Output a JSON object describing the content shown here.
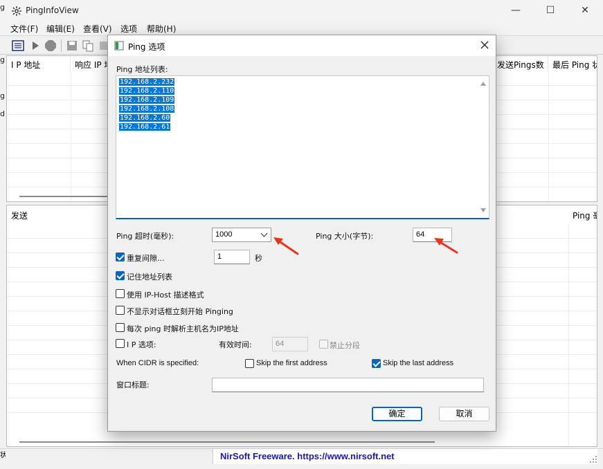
{
  "app": {
    "title": "PingInfoView",
    "window_controls": {
      "minimize": "—",
      "maximize": "☐",
      "close": "✕"
    }
  },
  "menu": [
    "文件(F)",
    "编辑(E)",
    "查看(V)",
    "选项",
    "帮助(H)"
  ],
  "top_table": {
    "columns": [
      "I P 地址",
      "响应 IP 地",
      "发送Pings数",
      "最后 Ping 状"
    ],
    "left_clipped_chars": [
      "g",
      "g",
      "g",
      "d"
    ]
  },
  "bottom_table": {
    "columns": [
      "发送",
      "Ping 毫。"
    ]
  },
  "status": {
    "left_text": "状",
    "link_text": "NirSoft Freeware. https://www.nirsoft.net"
  },
  "dialog": {
    "title": "Ping 选项",
    "address_list_label": "Ping 地址列表:",
    "addresses": [
      "192.168.2.232",
      "192.168.2.110",
      "192.168.2.109",
      "192.168.2.108",
      "192.168.2.60",
      "192.168.2.61"
    ],
    "timeout_label": "Ping 超时(毫秒):",
    "timeout_value": "1000",
    "size_label": "Ping 大小(字节):",
    "size_value": "64",
    "repeat_label": "重复间隙...",
    "repeat_checked": true,
    "repeat_value": "1",
    "repeat_unit": "秒",
    "remember_label": "记住地址列表",
    "remember_checked": true,
    "iphost_label": "使用 IP-Host 描述格式",
    "iphost_checked": false,
    "nodialog_label": "不显示对话框立刻开始 Pinging",
    "nodialog_checked": false,
    "resolve_label": "每次 ping 时解析主机名为IP地址",
    "resolve_checked": false,
    "ipopt_label": "I P 选项:",
    "ipopt_checked": false,
    "ttl_label": "有效时间:",
    "ttl_value": "64",
    "nofrag_label": "禁止分段",
    "nofrag_checked": false,
    "cidr_label": "When CIDR is specified:",
    "skip_first_label": "Skip the first address",
    "skip_first_checked": false,
    "skip_last_label": "Skip the last address",
    "skip_last_checked": true,
    "window_title_label": "窗口标题:",
    "window_title_value": "",
    "ok_label": "确定",
    "cancel_label": "取消"
  },
  "colors": {
    "selection": "#0078d4",
    "accent": "#0067c0",
    "annotation_arrow": "#e8341c",
    "link": "#1a1ab0"
  }
}
